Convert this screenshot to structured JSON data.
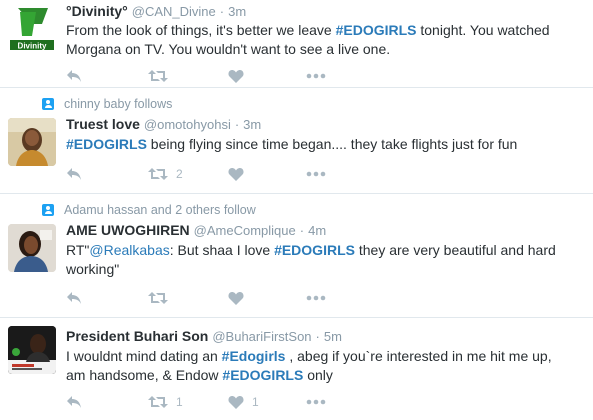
{
  "tweets": [
    {
      "context": "",
      "name": "°Divinity°",
      "handle": "@CAN_Divine",
      "time": "3m",
      "avatar_label": "Divinity",
      "segments": [
        {
          "t": "From the look of things, it's better we leave ",
          "k": "plain"
        },
        {
          "t": "#EDOGIRLS",
          "k": "hash"
        },
        {
          "t": " tonight. You watched Morgana on TV. You wouldn't want to see a live one.",
          "k": "plain"
        }
      ],
      "retweet_count": "",
      "like_count": ""
    },
    {
      "context": "chinny baby follows",
      "name": "Truest love",
      "handle": "@omotohyohsi",
      "time": "3m",
      "segments": [
        {
          "t": "#EDOGIRLS",
          "k": "hash"
        },
        {
          "t": " being flying since time began.... they take flights just for fun",
          "k": "plain"
        }
      ],
      "retweet_count": "2",
      "like_count": ""
    },
    {
      "context": "Adamu hassan and 2 others follow",
      "name": "AME UWOGHIREN",
      "handle": "@AmeComplique",
      "time": "4m",
      "segments": [
        {
          "t": "RT\"",
          "k": "plain"
        },
        {
          "t": "@Realkabas",
          "k": "link"
        },
        {
          "t": ": But shaa I love ",
          "k": "plain"
        },
        {
          "t": "#EDOGIRLS",
          "k": "hash"
        },
        {
          "t": " they are very beautiful and hard working\"",
          "k": "plain"
        }
      ],
      "retweet_count": "",
      "like_count": ""
    },
    {
      "context": "",
      "name": "President Buhari Son",
      "handle": "@BuhariFirstSon",
      "time": "5m",
      "segments": [
        {
          "t": "I wouldnt mind dating an ",
          "k": "plain"
        },
        {
          "t": "#Edogirls",
          "k": "hash"
        },
        {
          "t": " , abeg if you`re interested in me hit me up, am handsome, & Endow ",
          "k": "plain"
        },
        {
          "t": "#EDOGIRLS",
          "k": "hash"
        },
        {
          "t": " only",
          "k": "plain"
        }
      ],
      "retweet_count": "1",
      "like_count": "1"
    }
  ],
  "separator": "·",
  "colors": {
    "hashtag": "#2b7bb9",
    "meta": "#8899a6",
    "action_icon": "#aab8c2",
    "context_icon": "#1da1f2",
    "divider": "#e1e8ed"
  },
  "icons": [
    "reply-icon",
    "retweet-icon",
    "like-icon",
    "more-icon",
    "follow-context-icon"
  ]
}
